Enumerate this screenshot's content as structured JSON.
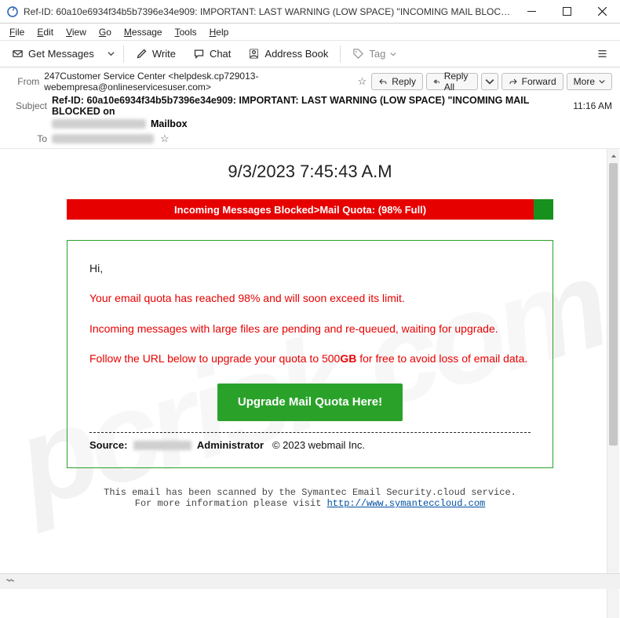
{
  "titlebar": {
    "title": "Ref-ID: 60a10e6934f34b5b7396e34e909: IMPORTANT: LAST WARNING (LOW SPACE) \"INCOMING MAIL BLOCKED on rimvydas..."
  },
  "menubar": [
    "File",
    "Edit",
    "View",
    "Go",
    "Message",
    "Tools",
    "Help"
  ],
  "toolbar": {
    "getmsgs": "Get Messages",
    "write": "Write",
    "chat": "Chat",
    "addrbook": "Address Book",
    "tag": "Tag"
  },
  "header": {
    "from_label": "From",
    "from_value": "247Customer Service Center <helpdesk.cp729013-webempresa@onlineservicesuser.com>",
    "subject_label": "Subject",
    "subject_value": "Ref-ID: 60a10e6934f34b5b7396e34e909: IMPORTANT: LAST WARNING (LOW SPACE) \"INCOMING MAIL BLOCKED on",
    "subject_suffix": " Mailbox",
    "to_label": "To",
    "time": "11:16 AM"
  },
  "actions": {
    "reply": "Reply",
    "replyall": "Reply All",
    "forward": "Forward",
    "more": "More"
  },
  "body": {
    "datetime": "9/3/2023 7:45:43 A.M",
    "quota_banner": "Incoming Messages Blocked>Mail Quota: (98% Full)",
    "greeting": "Hi,",
    "p1": "Your email quota has reached 98% and will soon exceed its limit.",
    "p2": "Incoming messages with large files are pending and re-queued, waiting for upgrade.",
    "p3a": "Follow the URL below to upgrade your quota to 500",
    "p3b": "GB",
    "p3c": " for free to avoid loss of email data.",
    "upgrade_btn": "Upgrade Mail Quota Here!",
    "source_label": "Source:",
    "source_role": "Administrator",
    "source_copyright": "© 2023   webmail Inc.",
    "scan_line1": "This email has been scanned by the Symantec Email Security.cloud service.",
    "scan_line2_pre": "For more information please visit ",
    "scan_link": "http://www.symanteccloud.com"
  },
  "watermark": "pcrisk.com"
}
